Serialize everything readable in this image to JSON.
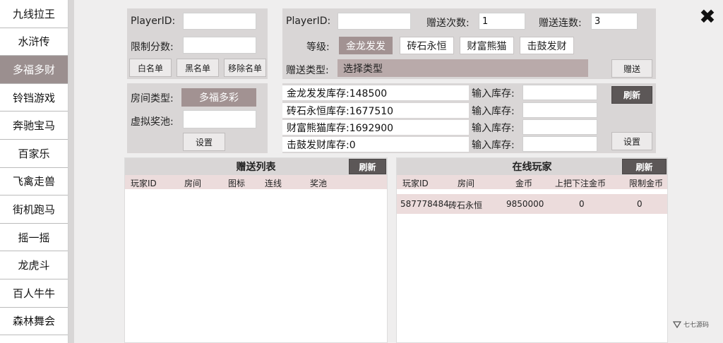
{
  "sidebar": {
    "items": [
      "九线拉王",
      "水浒传",
      "多福多财",
      "铃铛游戏",
      "奔驰宝马",
      "百家乐",
      "飞禽走兽",
      "街机跑马",
      "摇一摇",
      "龙虎斗",
      "百人牛牛",
      "森林舞会"
    ],
    "active_index": 2
  },
  "left_top": {
    "player_label": "PlayerID:",
    "limit_label": "限制分数:",
    "whitelist": "白名单",
    "blacklist": "黑名单",
    "remove": "移除名单"
  },
  "left_mid": {
    "room_type_label": "房间类型:",
    "room_type_value": "多福多彩",
    "pool_label": "虚拟奖池:",
    "set_btn": "设置"
  },
  "gift": {
    "player_label": "PlayerID:",
    "count_label": "赠送次数:",
    "count_value": "1",
    "streak_label": "赠送连数:",
    "streak_value": "3",
    "level_label": "等级:",
    "levels": [
      "金龙发发",
      "砖石永恒",
      "财富熊猫",
      "击鼓发财"
    ],
    "type_label": "赠送类型:",
    "type_value": "选择类型",
    "send_btn": "赠送"
  },
  "stock": {
    "rows": [
      {
        "label": "金龙发发库存:148500",
        "input_label": "输入库存:"
      },
      {
        "label": "砖石永恒库存:1677510",
        "input_label": "输入库存:"
      },
      {
        "label": "财富熊猫库存:1692900",
        "input_label": "输入库存:"
      },
      {
        "label": "击鼓发财库存:0",
        "input_label": "输入库存:"
      }
    ],
    "refresh_btn": "刷新",
    "set_btn": "设置"
  },
  "gift_list": {
    "title": "赠送列表",
    "refresh_btn": "刷新",
    "headers": [
      "玩家ID",
      "房间",
      "图标",
      "连线",
      "奖池"
    ]
  },
  "online": {
    "title": "在线玩家",
    "refresh_btn": "刷新",
    "headers": [
      "玩家ID",
      "房间",
      "金币",
      "上把下注金币",
      "限制金币"
    ],
    "rows": [
      [
        "587778484",
        "砖石永恒",
        "9850000",
        "0",
        "0"
      ]
    ]
  },
  "close_icon": "✖",
  "watermark": "七七源码"
}
